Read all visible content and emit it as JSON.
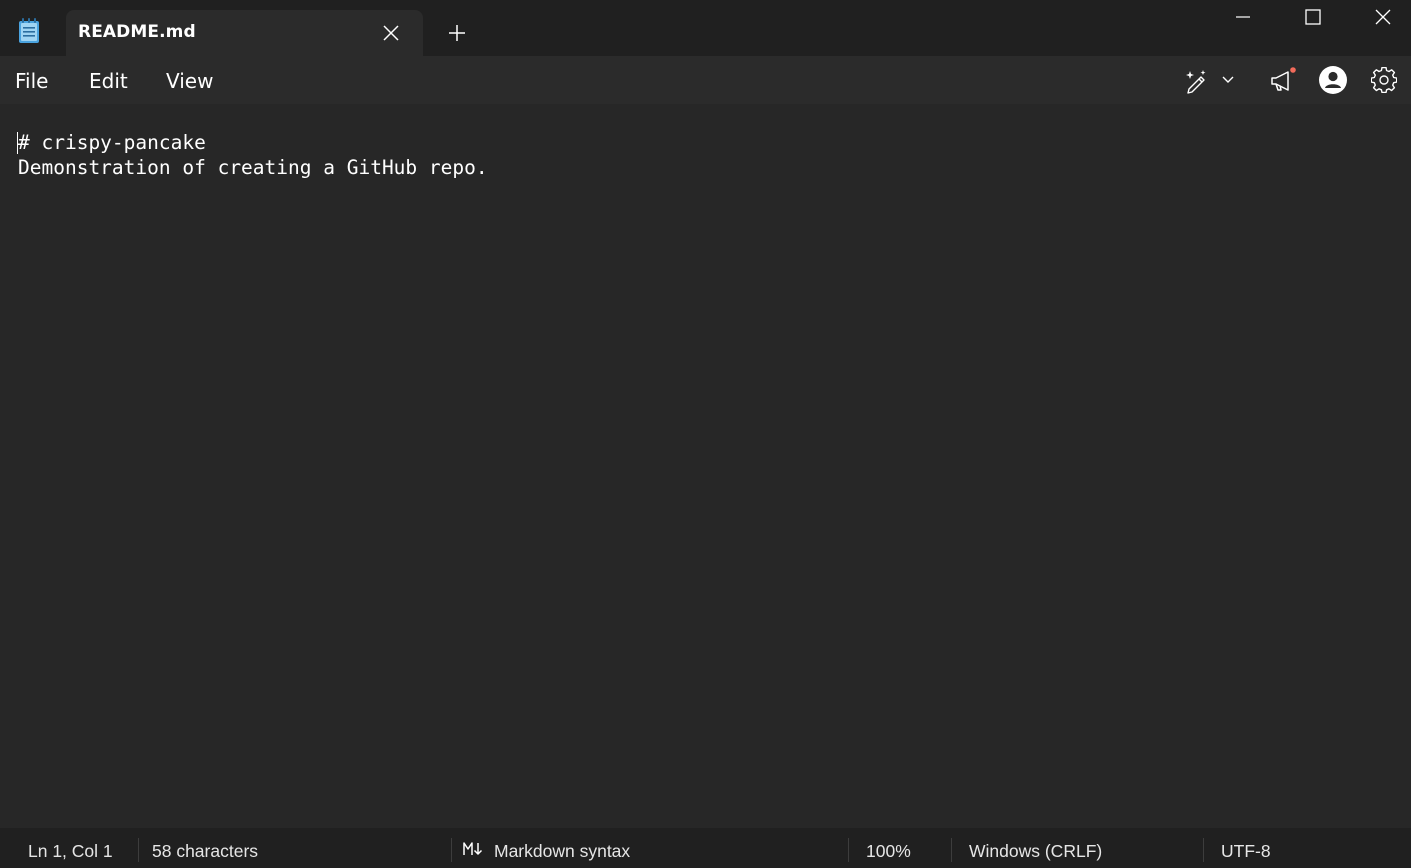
{
  "app": {
    "icon": "notepad-icon"
  },
  "tab": {
    "title": "README.md",
    "close_icon": "close-icon"
  },
  "titlebar": {
    "new_tab_icon": "plus-icon",
    "minimize_icon": "minimize-icon",
    "maximize_icon": "maximize-icon",
    "close_icon": "close-icon"
  },
  "menu": {
    "file": "File",
    "edit": "Edit",
    "view": "View"
  },
  "toolbar": {
    "copilot_icon": "copilot-rewrite-icon",
    "copilot_chevron": "chevron-down-icon",
    "feedback_icon": "megaphone-icon",
    "feedback_badge_color": "#f26b5b",
    "account_icon": "account-icon",
    "settings_icon": "gear-icon"
  },
  "editor": {
    "lines": [
      "# crispy-pancake",
      "Demonstration of creating a GitHub repo."
    ]
  },
  "status": {
    "position": "Ln 1, Col 1",
    "characters": "58 characters",
    "markdown_icon": "markdown-icon",
    "markdown": "Markdown syntax",
    "zoom": "100%",
    "line_ending": "Windows (CRLF)",
    "encoding": "UTF-8"
  },
  "colors": {
    "titlebar_bg": "#202020",
    "tab_bg": "#2b2b2b",
    "editor_bg": "#272727",
    "text": "#ffffff",
    "app_icon_blue": "#4aa3df"
  }
}
